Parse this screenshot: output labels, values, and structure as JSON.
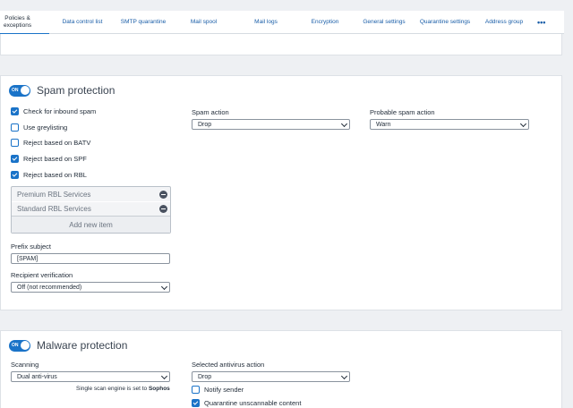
{
  "tabs": [
    {
      "label_line1": "Policies &",
      "label_line2": "exceptions",
      "active": true
    },
    {
      "label": "Data control list"
    },
    {
      "label": "SMTP quarantine"
    },
    {
      "label": "Mail spool"
    },
    {
      "label": "Mail logs"
    },
    {
      "label": "Encryption"
    },
    {
      "label": "General settings"
    },
    {
      "label": "Quarantine settings"
    },
    {
      "label": "Address group"
    }
  ],
  "tabs_more": "•••",
  "spam": {
    "toggle": "ON",
    "title": "Spam protection",
    "checks": [
      {
        "label": "Check for inbound spam",
        "checked": true
      },
      {
        "label": "Use greylisting",
        "checked": false
      },
      {
        "label": "Reject based on BATV",
        "checked": false
      },
      {
        "label": "Reject based on SPF",
        "checked": true
      },
      {
        "label": "Reject based on RBL",
        "checked": true
      }
    ],
    "rbl_items": [
      "Premium RBL Services",
      "Standard RBL Services"
    ],
    "rbl_add": "Add new item",
    "prefix_label": "Prefix subject",
    "prefix_value": "[SPAM]",
    "recipient_label": "Recipient verification",
    "recipient_value": "Off (not recommended)",
    "spam_action_label": "Spam action",
    "spam_action_value": "Drop",
    "probable_label": "Probable spam action",
    "probable_value": "Warn"
  },
  "malware": {
    "toggle": "ON",
    "title": "Malware protection",
    "scanning_label": "Scanning",
    "scanning_value": "Dual anti-virus",
    "note_prefix": "Single scan engine is set to ",
    "note_engine": "Sophos",
    "action_label": "Selected antivirus action",
    "action_value": "Drop",
    "notify_label": "Notify sender",
    "notify_checked": false,
    "quarantine_label": "Quarantine unscannable content",
    "quarantine_checked": true
  },
  "colors": {
    "accent": "#1a73c8",
    "link": "#1a5ea8"
  }
}
